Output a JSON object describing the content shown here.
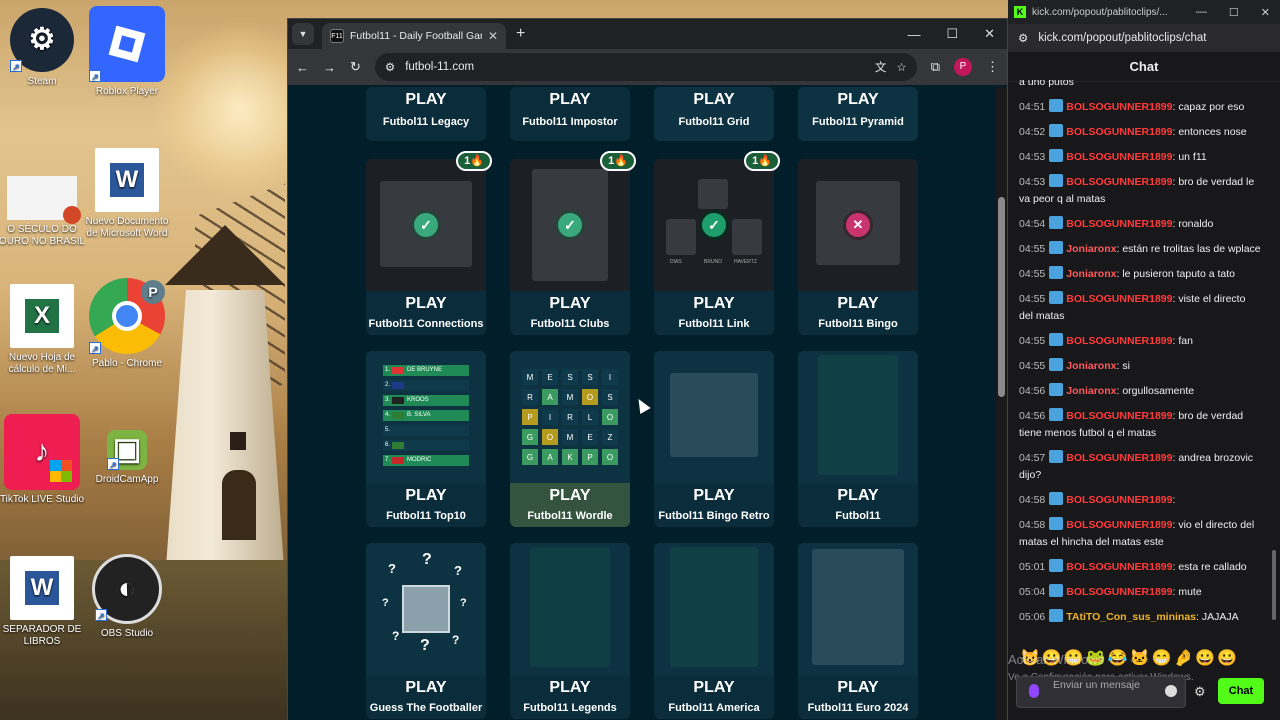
{
  "desktop": {
    "icons": [
      {
        "label": "Steam",
        "icon": "steam-icon",
        "color": "#1b2838"
      },
      {
        "label": "Roblox Player",
        "icon": "roblox-icon",
        "color": "#3366ff"
      },
      {
        "label": "O SÉCULO DO OURO NO BRASIL",
        "icon": "powerpoint-file-icon",
        "color": "#f4f4f4"
      },
      {
        "label": "Nuevo Documento de Microsoft Word",
        "icon": "word-icon",
        "color": "#2b579a"
      },
      {
        "label": "Nuevo Hoja de cálculo de Mi...",
        "icon": "excel-icon",
        "color": "#217346"
      },
      {
        "label": "Pablo - Chrome",
        "icon": "chrome-icon",
        "color": "#4285f4"
      },
      {
        "label": "TikTok LIVE Studio",
        "icon": "tiktok-icon",
        "color": "#ee1d52"
      },
      {
        "label": "DroidCamApp",
        "icon": "droidcam-icon",
        "color": "#7cb342"
      },
      {
        "label": "SEPARADOR DE LIBROS",
        "icon": "word-icon",
        "color": "#2b579a"
      },
      {
        "label": "OBS Studio",
        "icon": "obs-icon",
        "color": "#222222"
      }
    ]
  },
  "browser": {
    "tab_title": "Futbol11 - Daily Football Game",
    "tab_favicon": "F11",
    "url": "futbol-11.com",
    "profile_initial": "P",
    "play_label": "PLAY",
    "top_games": [
      "Futbol11 Legacy",
      "Futbol11 Impostor",
      "Futbol11 Grid",
      "Futbol11 Pyramid"
    ],
    "row2_games": [
      "Futbol11 Connections",
      "Futbol11 Clubs",
      "Futbol11 Link",
      "Futbol11 Bingo"
    ],
    "streak": "1🔥",
    "link_players": [
      "DIAS",
      "BRUNO",
      "HAVERTZ"
    ],
    "row3_games": [
      "Futbol11 Top10",
      "Futbol11 Wordle",
      "Futbol11 Bingo Retro",
      "Futbol11"
    ],
    "top10_entries": [
      {
        "n": "1.",
        "name": "DE BRUYNE"
      },
      {
        "n": "2.",
        "name": ""
      },
      {
        "n": "3.",
        "name": "KROOS"
      },
      {
        "n": "4.",
        "name": "B. SILVA"
      },
      {
        "n": "5.",
        "name": ""
      },
      {
        "n": "6.",
        "name": ""
      },
      {
        "n": "7.",
        "name": "MODRIC"
      }
    ],
    "wordle_letters": [
      "M",
      "E",
      "S",
      "S",
      "I",
      "R",
      "A",
      "M",
      "O",
      "S",
      "P",
      "I",
      "R",
      "L",
      "O",
      "G",
      "O",
      "M",
      "E",
      "Z",
      "G",
      "A",
      "K",
      "P",
      "O"
    ],
    "row4_games": [
      "Guess The Footballer",
      "Futbol11 Legends",
      "Futbol11 America",
      "Futbol11 Euro 2024"
    ],
    "guess_marks": [
      "?",
      "?",
      "?",
      "?",
      "?",
      "?",
      "?",
      "?"
    ]
  },
  "chat": {
    "window_title": "kick.com/popout/pablitoclips/...",
    "url": "kick.com/popout/pablitoclips/chat",
    "header": "Chat",
    "first_line": "a uno putos",
    "messages": [
      {
        "time": "04:51",
        "user": "BOLSOGUNNER1899",
        "text": "capaz por eso",
        "cls": "u-bolso"
      },
      {
        "time": "04:52",
        "user": "BOLSOGUNNER1899",
        "text": "entonces nose",
        "cls": "u-bolso"
      },
      {
        "time": "04:53",
        "user": "BOLSOGUNNER1899",
        "text": "un f11",
        "cls": "u-bolso"
      },
      {
        "time": "04:53",
        "user": "BOLSOGUNNER1899",
        "text": "bro de verdad le va peor q al matas",
        "cls": "u-bolso"
      },
      {
        "time": "04:54",
        "user": "BOLSOGUNNER1899",
        "text": "ronaldo",
        "cls": "u-bolso"
      },
      {
        "time": "04:55",
        "user": "Joniaronx",
        "text": "están re trolitas las de wplace",
        "cls": "u-joni"
      },
      {
        "time": "04:55",
        "user": "Joniaronx",
        "text": "le pusieron taputo a tato",
        "cls": "u-joni"
      },
      {
        "time": "04:55",
        "user": "BOLSOGUNNER1899",
        "text": "viste el directo del matas",
        "cls": "u-bolso"
      },
      {
        "time": "04:55",
        "user": "BOLSOGUNNER1899",
        "text": "fan",
        "cls": "u-bolso"
      },
      {
        "time": "04:55",
        "user": "Joniaronx",
        "text": "si",
        "cls": "u-joni"
      },
      {
        "time": "04:56",
        "user": "Joniaronx",
        "text": "orgullosamente",
        "cls": "u-joni"
      },
      {
        "time": "04:56",
        "user": "BOLSOGUNNER1899",
        "text": "bro de verdad tiene menos futbol q el matas",
        "cls": "u-bolso"
      },
      {
        "time": "04:57",
        "user": "BOLSOGUNNER1899",
        "text": "andrea brozovic dijo?",
        "cls": "u-bolso"
      },
      {
        "time": "04:58",
        "user": "BOLSOGUNNER1899",
        "text": "",
        "cls": "u-bolso"
      },
      {
        "time": "04:58",
        "user": "BOLSOGUNNER1899",
        "text": "vio el directo del matas el hincha del matas este",
        "cls": "u-bolso"
      },
      {
        "time": "05:01",
        "user": "BOLSOGUNNER1899",
        "text": "esta re callado",
        "cls": "u-bolso"
      },
      {
        "time": "05:04",
        "user": "BOLSOGUNNER1899",
        "text": "mute",
        "cls": "u-bolso"
      },
      {
        "time": "05:06",
        "user": "TAtiTO_Con_sus_mininas",
        "text": "JAJAJA",
        "cls": "u-tatito"
      }
    ],
    "emotes": "😺😀😬🐸😂🐱😁🤌😀😀",
    "watermark_1": "Activar Windows",
    "watermark_2": "Ve a Configuración para activar Windows.",
    "input_placeholder": "Enviar un mensaje",
    "send_label": "Chat"
  }
}
